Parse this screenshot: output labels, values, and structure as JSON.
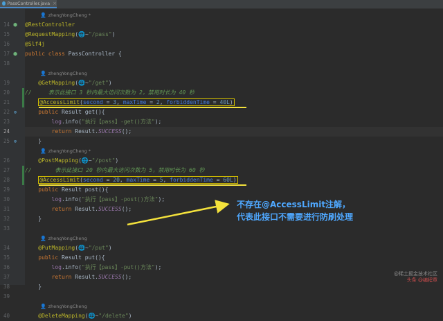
{
  "tab": {
    "filename": "PassController.java"
  },
  "icons": {
    "file": "java-file-icon",
    "bean": "spring-bean-icon",
    "override": "implement-icon"
  },
  "colors": {
    "highlight": "#f4e23c",
    "callout": "#4fa8ff",
    "background": "#2b2b2b"
  },
  "editor": {
    "current_line": "24",
    "lines": [
      {
        "type": "author",
        "text": "zhengYongCheng *"
      },
      {
        "ln": "14",
        "tokens": [
          [
            "ann",
            "@RestController"
          ]
        ]
      },
      {
        "ln": "15",
        "tokens": [
          [
            "ann",
            "@RequestMapping"
          ],
          [
            "",
            "("
          ],
          [
            "web",
            "🌐~"
          ],
          [
            "str",
            "\"/pass\""
          ],
          [
            "",
            ")"
          ]
        ]
      },
      {
        "ln": "16",
        "tokens": [
          [
            "ann",
            "@Slf4j"
          ]
        ]
      },
      {
        "ln": "17",
        "tokens": [
          [
            "kw",
            "public class "
          ],
          [
            "",
            "PassController {"
          ]
        ]
      },
      {
        "ln": "18",
        "tokens": []
      },
      {
        "type": "author",
        "text": "zhengYongCheng"
      },
      {
        "ln": "19",
        "tokens": [
          [
            "",
            "    "
          ],
          [
            "ann",
            "@GetMapping"
          ],
          [
            "",
            "("
          ],
          [
            "web",
            "🌐~"
          ],
          [
            "str",
            "\"/get\""
          ],
          [
            "",
            ")"
          ]
        ]
      },
      {
        "ln": "20",
        "tokens": [
          [
            "comment",
            "//     表示此接口 3 秒内最大访问次数为 2，禁用时长为 40 秒"
          ]
        ]
      },
      {
        "ln": "21",
        "tokens": [
          [
            "",
            "    "
          ],
          [
            "ann",
            "@AccessLimit"
          ],
          [
            "",
            "("
          ],
          [
            "param",
            "second"
          ],
          [
            "",
            " = "
          ],
          [
            "num",
            "3"
          ],
          [
            "",
            ", "
          ],
          [
            "param",
            "maxTime"
          ],
          [
            "",
            " = "
          ],
          [
            "num",
            "2"
          ],
          [
            "",
            ", "
          ],
          [
            "param",
            "forbiddenTime"
          ],
          [
            "",
            " = "
          ],
          [
            "num",
            "40L"
          ],
          [
            "",
            ")"
          ]
        ]
      },
      {
        "ln": "22",
        "tokens": [
          [
            "",
            "    "
          ],
          [
            "kw",
            "public "
          ],
          [
            "",
            "Result get(){"
          ]
        ]
      },
      {
        "ln": "23",
        "tokens": [
          [
            "",
            "        "
          ],
          [
            "logvar",
            "log"
          ],
          [
            "",
            ".info("
          ],
          [
            "str",
            "\"执行【pass】-get()方法\""
          ],
          [
            "",
            ");"
          ]
        ]
      },
      {
        "ln": "24",
        "tokens": [
          [
            "",
            "        "
          ],
          [
            "kw",
            "return "
          ],
          [
            "",
            "Result."
          ],
          [
            "static",
            "SUCCESS"
          ],
          [
            "",
            "();"
          ]
        ]
      },
      {
        "ln": "25",
        "tokens": [
          [
            "",
            "    }"
          ]
        ]
      },
      {
        "type": "author",
        "text": "zhengYongCheng *"
      },
      {
        "ln": "26",
        "tokens": [
          [
            "",
            "    "
          ],
          [
            "ann",
            "@PostMapping"
          ],
          [
            "",
            "("
          ],
          [
            "web",
            "🌐~"
          ],
          [
            "str",
            "\"/post\""
          ],
          [
            "",
            ")"
          ]
        ]
      },
      {
        "ln": "27",
        "tokens": [
          [
            "comment",
            "//       表示此接口 20 秒内最大访问次数为 5，禁用时长为 60 秒"
          ]
        ]
      },
      {
        "ln": "28",
        "tokens": [
          [
            "",
            "    "
          ],
          [
            "ann",
            "@AccessLimit"
          ],
          [
            "",
            "("
          ],
          [
            "param",
            "second"
          ],
          [
            "",
            " = "
          ],
          [
            "num",
            "20"
          ],
          [
            "",
            ", "
          ],
          [
            "param",
            "maxTime"
          ],
          [
            "",
            " = "
          ],
          [
            "num",
            "5"
          ],
          [
            "",
            ", "
          ],
          [
            "param",
            "forbiddenTime"
          ],
          [
            "",
            " = "
          ],
          [
            "num",
            "60L"
          ],
          [
            "",
            ")"
          ]
        ]
      },
      {
        "ln": "29",
        "tokens": [
          [
            "",
            "    "
          ],
          [
            "kw",
            "public "
          ],
          [
            "",
            "Result post(){"
          ]
        ]
      },
      {
        "ln": "30",
        "tokens": [
          [
            "",
            "        "
          ],
          [
            "logvar",
            "log"
          ],
          [
            "",
            ".info("
          ],
          [
            "str",
            "\"执行【pass】-post()方法\""
          ],
          [
            "",
            ");"
          ]
        ]
      },
      {
        "ln": "31",
        "tokens": [
          [
            "",
            "        "
          ],
          [
            "kw",
            "return "
          ],
          [
            "",
            "Result."
          ],
          [
            "static",
            "SUCCESS"
          ],
          [
            "",
            "();"
          ]
        ]
      },
      {
        "ln": "32",
        "tokens": [
          [
            "",
            "    }"
          ]
        ]
      },
      {
        "ln": "33",
        "tokens": []
      },
      {
        "type": "author",
        "text": "zhengYongCheng"
      },
      {
        "ln": "34",
        "tokens": [
          [
            "",
            "    "
          ],
          [
            "ann",
            "@PutMapping"
          ],
          [
            "",
            "("
          ],
          [
            "web",
            "🌐~"
          ],
          [
            "str",
            "\"/put\""
          ],
          [
            "",
            ")"
          ]
        ]
      },
      {
        "ln": "35",
        "tokens": [
          [
            "",
            "    "
          ],
          [
            "kw",
            "public "
          ],
          [
            "",
            "Result put(){"
          ]
        ]
      },
      {
        "ln": "36",
        "tokens": [
          [
            "",
            "        "
          ],
          [
            "logvar",
            "log"
          ],
          [
            "",
            ".info("
          ],
          [
            "str",
            "\"执行【pass】-put()方法\""
          ],
          [
            "",
            ");"
          ]
        ]
      },
      {
        "ln": "37",
        "tokens": [
          [
            "",
            "        "
          ],
          [
            "kw",
            "return "
          ],
          [
            "",
            "Result."
          ],
          [
            "static",
            "SUCCESS"
          ],
          [
            "",
            "();"
          ]
        ]
      },
      {
        "ln": "38",
        "tokens": [
          [
            "",
            "    }"
          ]
        ]
      },
      {
        "ln": "39",
        "tokens": []
      },
      {
        "type": "author",
        "text": "zhengYongCheng"
      },
      {
        "ln": "40",
        "tokens": [
          [
            "",
            "    "
          ],
          [
            "ann",
            "@DeleteMapping"
          ],
          [
            "",
            "("
          ],
          [
            "web",
            "🌐~"
          ],
          [
            "str",
            "\"/delete\""
          ],
          [
            "",
            ")"
          ]
        ]
      }
    ]
  },
  "callout": {
    "line1": "不存在@AccessLimit注解，",
    "line2": "代表此接口不需要进行防刷处理"
  },
  "watermark": {
    "line1": "@稀土掘金技术社区",
    "line2": "头条 @编程章"
  }
}
